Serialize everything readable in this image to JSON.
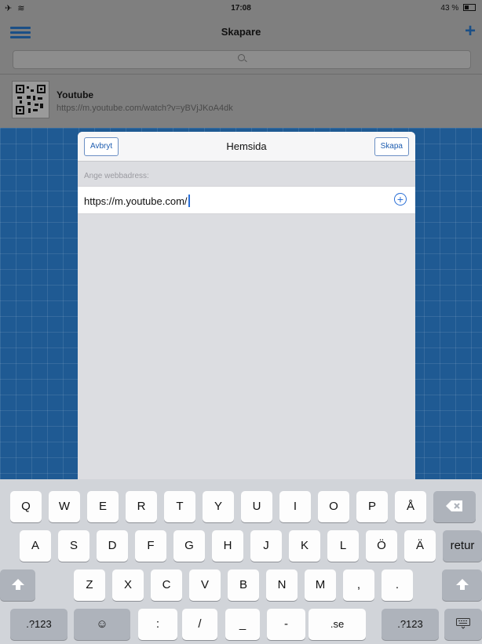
{
  "status": {
    "left": "✈ ︎≋",
    "time": "17:08",
    "battery": "43 %"
  },
  "nav": {
    "title": "Skapare"
  },
  "item": {
    "title": "Youtube",
    "url": "https://m.youtube.com/watch?v=yBVjJKoA4dk"
  },
  "modal": {
    "cancel": "Avbryt",
    "title": "Hemsida",
    "create": "Skapa",
    "label": "Ange webbadress:",
    "value": "https://m.youtube.com/"
  },
  "keyboard": {
    "row1": [
      "Q",
      "W",
      "E",
      "R",
      "T",
      "Y",
      "U",
      "I",
      "O",
      "P",
      "Å"
    ],
    "row2": [
      "A",
      "S",
      "D",
      "F",
      "G",
      "H",
      "J",
      "K",
      "L",
      "Ö",
      "Ä"
    ],
    "row3": [
      "Z",
      "X",
      "C",
      "V",
      "B",
      "N",
      "M",
      ",",
      "."
    ],
    "return": "retur",
    "numbers": ".?123",
    "colon": ":",
    "slash": "/",
    "underscore": "_",
    "dash": "-",
    "se": ".se",
    "numbers2": ".?123"
  }
}
